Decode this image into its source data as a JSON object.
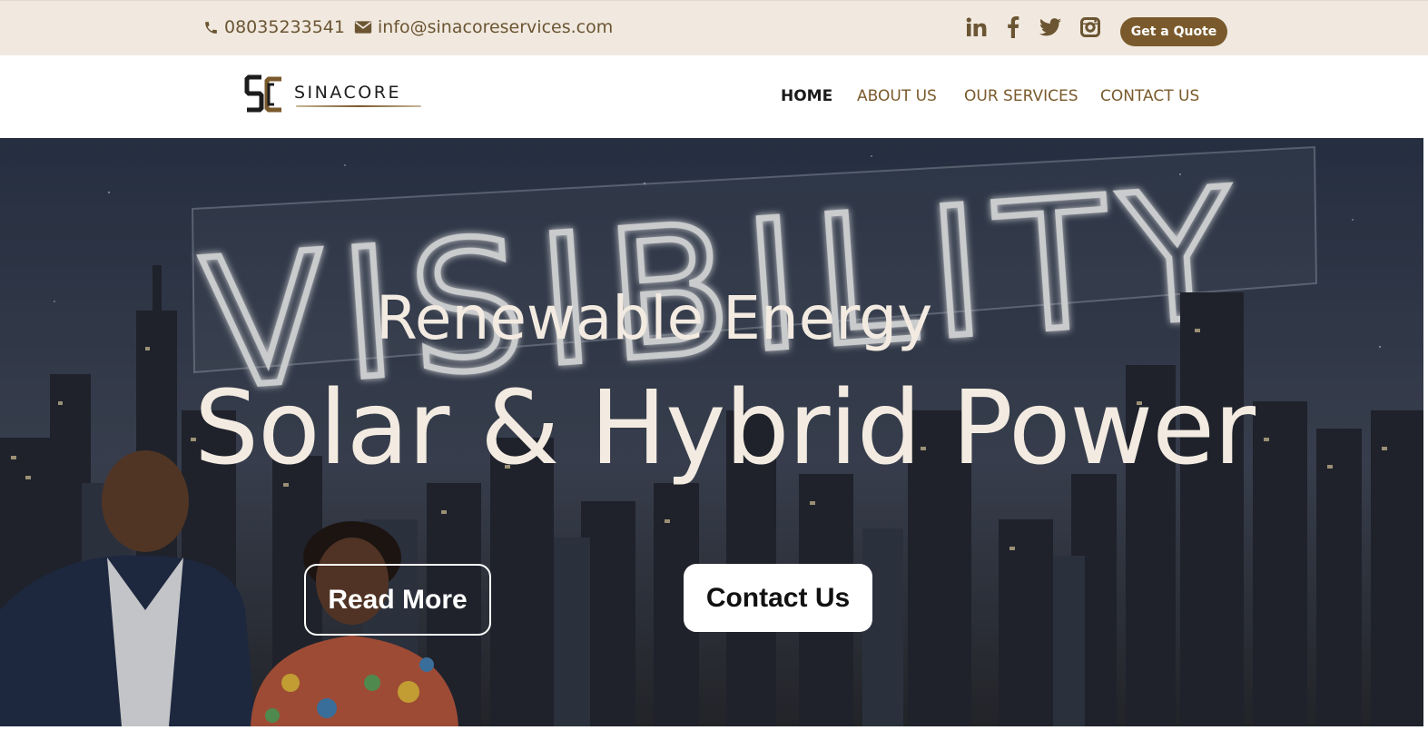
{
  "topbar": {
    "phone": "08035233541",
    "email": "info@sinacoreservices.com",
    "social_icons": [
      "linkedin-icon",
      "facebook-icon",
      "twitter-icon",
      "instagram-icon"
    ],
    "quote_label": "Get a Quote"
  },
  "brand": {
    "name": "SINACORE"
  },
  "nav": {
    "items": [
      {
        "label": "HOME",
        "active": true
      },
      {
        "label": "ABOUT US",
        "active": false
      },
      {
        "label": "OUR SERVICES",
        "active": false
      },
      {
        "label": "CONTACT US",
        "active": false
      }
    ]
  },
  "hero": {
    "sign_text": "VISIBILITY",
    "subtitle": "Renewable Energy",
    "title": "Solar & Hybrid Power",
    "read_more_label": "Read More",
    "contact_label": "Contact Us"
  },
  "colors": {
    "topbar_bg": "#f1e9df",
    "accent": "#7a5a2c",
    "hero_text": "#f3ebe1"
  }
}
